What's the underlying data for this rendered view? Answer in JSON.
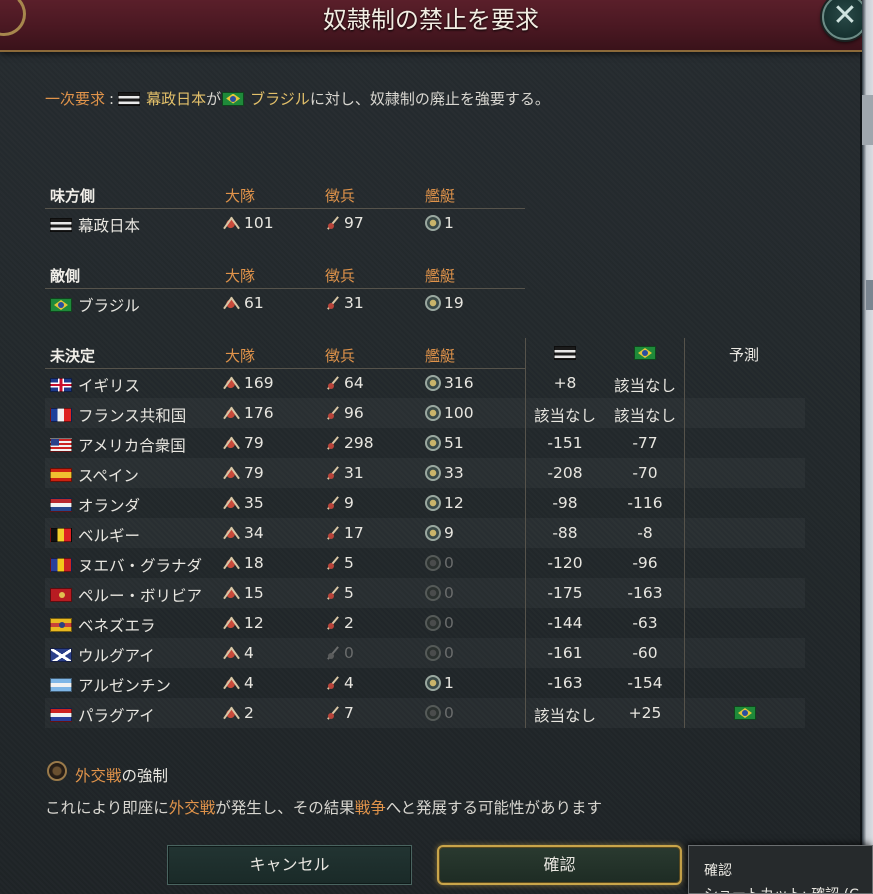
{
  "window": {
    "title": "奴隷制の禁止を要求",
    "close_label": "✕"
  },
  "requirement": {
    "prefix": "一次要求",
    "separator": ":",
    "actor": "幕政日本",
    "particle_ga": "が",
    "target": "ブラジル",
    "suffix": "に対し、奴隷制の廃止を強要する。"
  },
  "columns": {
    "army": "大隊",
    "conscripts": "徴兵",
    "ships": "艦艇",
    "prediction": "予測"
  },
  "allies": {
    "heading": "味方側",
    "rows": [
      {
        "flag": "shogun",
        "name": "幕政日本",
        "army": "101",
        "conscripts": "97",
        "ships": "1"
      }
    ]
  },
  "enemies": {
    "heading": "敵側",
    "rows": [
      {
        "flag": "brazil",
        "name": "ブラジル",
        "army": "61",
        "conscripts": "31",
        "ships": "19"
      }
    ]
  },
  "undecided": {
    "heading": "未決定",
    "rows": [
      {
        "flag": "uk",
        "name": "イギリス",
        "army": "169",
        "conscripts": "64",
        "ships": "316",
        "japan": "+8",
        "brazil": "該当なし",
        "prediction": ""
      },
      {
        "flag": "fr",
        "name": "フランス共和国",
        "army": "176",
        "conscripts": "96",
        "ships": "100",
        "japan": "該当なし",
        "brazil": "該当なし",
        "prediction": ""
      },
      {
        "flag": "us",
        "name": "アメリカ合衆国",
        "army": "79",
        "conscripts": "298",
        "ships": "51",
        "japan": "-151",
        "brazil": "-77",
        "prediction": ""
      },
      {
        "flag": "es",
        "name": "スペイン",
        "army": "79",
        "conscripts": "31",
        "ships": "33",
        "japan": "-208",
        "brazil": "-70",
        "prediction": ""
      },
      {
        "flag": "nl",
        "name": "オランダ",
        "army": "35",
        "conscripts": "9",
        "ships": "12",
        "japan": "-98",
        "brazil": "-116",
        "prediction": ""
      },
      {
        "flag": "be",
        "name": "ベルギー",
        "army": "34",
        "conscripts": "17",
        "ships": "9",
        "japan": "-88",
        "brazil": "-8",
        "prediction": ""
      },
      {
        "flag": "ng",
        "name": "ヌエバ・グラナダ",
        "army": "18",
        "conscripts": "5",
        "ships": "0",
        "japan": "-120",
        "brazil": "-96",
        "prediction": ""
      },
      {
        "flag": "pb",
        "name": "ペルー・ボリビア",
        "army": "15",
        "conscripts": "5",
        "ships": "0",
        "japan": "-175",
        "brazil": "-163",
        "prediction": ""
      },
      {
        "flag": "ve",
        "name": "ベネズエラ",
        "army": "12",
        "conscripts": "2",
        "ships": "0",
        "japan": "-144",
        "brazil": "-63",
        "prediction": ""
      },
      {
        "flag": "uy",
        "name": "ウルグアイ",
        "army": "4",
        "conscripts": "0",
        "ships": "0",
        "japan": "-161",
        "brazil": "-60",
        "prediction": ""
      },
      {
        "flag": "ar",
        "name": "アルゼンチン",
        "army": "4",
        "conscripts": "4",
        "ships": "1",
        "japan": "-163",
        "brazil": "-154",
        "prediction": ""
      },
      {
        "flag": "py",
        "name": "パラグアイ",
        "army": "2",
        "conscripts": "7",
        "ships": "0",
        "japan": "該当なし",
        "brazil": "+25",
        "prediction": "brazil-flag"
      }
    ]
  },
  "diplomatic": {
    "option_term": "外交戦",
    "option_rest": "の強制",
    "desc_1": "これにより即座に",
    "desc_term1": "外交戦",
    "desc_2": "が発生し、その結果",
    "desc_term2": "戦争",
    "desc_3": "へと発展する可能性があります"
  },
  "buttons": {
    "cancel": "キャンセル",
    "confirm": "確認"
  },
  "tooltip": {
    "title": "確認",
    "shortcut": "ショートカット: 確認 (C"
  },
  "colors": {
    "accent_orange": "#e0934a",
    "positive": "#6fcf52",
    "negative": "#e0463a",
    "title_bar": "#4a1822",
    "confirm_border": "#c9a54a"
  }
}
